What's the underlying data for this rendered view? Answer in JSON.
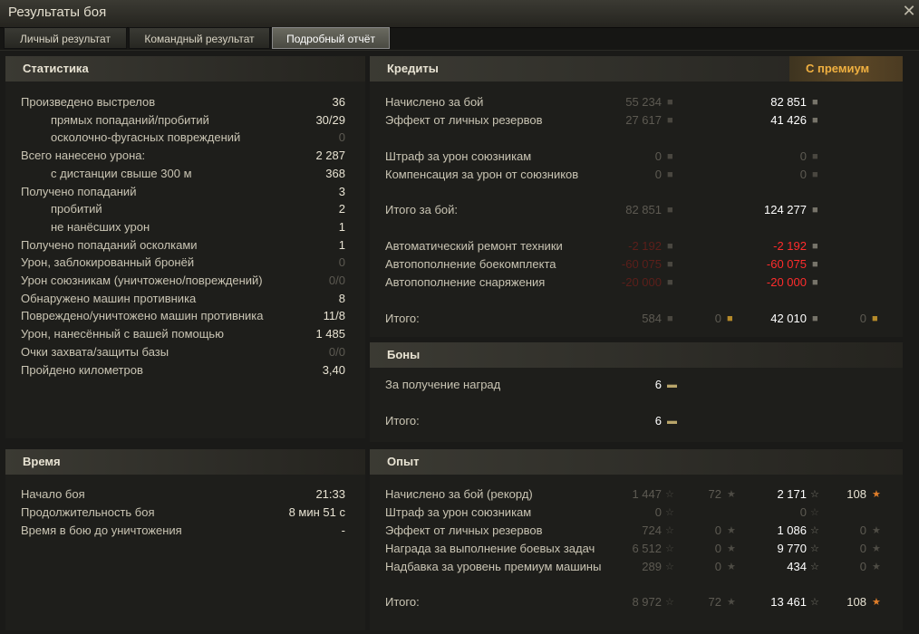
{
  "window": {
    "title": "Результаты боя"
  },
  "tabs": [
    "Личный результат",
    "Командный результат",
    "Подробный отчёт"
  ],
  "stats": {
    "header": "Статистика",
    "rows": [
      {
        "label": "Произведено выстрелов",
        "value": "36",
        "indent": false,
        "dim": false
      },
      {
        "label": "прямых попаданий/пробитий",
        "value": "30/29",
        "indent": true,
        "dim": false
      },
      {
        "label": "осколочно-фугасных повреждений",
        "value": "0",
        "indent": true,
        "dim": true
      },
      {
        "label": "Всего нанесено урона:",
        "value": "2 287",
        "indent": false,
        "dim": false
      },
      {
        "label": "с дистанции свыше 300 м",
        "value": "368",
        "indent": true,
        "dim": false
      },
      {
        "label": "Получено попаданий",
        "value": "3",
        "indent": false,
        "dim": false
      },
      {
        "label": "пробитий",
        "value": "2",
        "indent": true,
        "dim": false
      },
      {
        "label": "не нанёсших урон",
        "value": "1",
        "indent": true,
        "dim": false
      },
      {
        "label": "Получено попаданий осколками",
        "value": "1",
        "indent": false,
        "dim": false
      },
      {
        "label": "Урон, заблокированный бронёй",
        "value": "0",
        "indent": false,
        "dim": true
      },
      {
        "label": "Урон союзникам (уничтожено/повреждений)",
        "value": "0/0",
        "indent": false,
        "dim": true
      },
      {
        "label": "Обнаружено машин противника",
        "value": "8",
        "indent": false,
        "dim": false
      },
      {
        "label": "Повреждено/уничтожено машин противника",
        "value": "11/8",
        "indent": false,
        "dim": false
      },
      {
        "label": "Урон, нанесённый с вашей помощью",
        "value": "1 485",
        "indent": false,
        "dim": false
      },
      {
        "label": "Очки захвата/защиты базы",
        "value": "0/0",
        "indent": false,
        "dim": true
      },
      {
        "label": "Пройдено километров",
        "value": "3,40",
        "indent": false,
        "dim": false
      }
    ]
  },
  "time": {
    "header": "Время",
    "rows": [
      {
        "label": "Начало боя",
        "value": "21:33"
      },
      {
        "label": "Продолжительность боя",
        "value": "8 мин 51 с"
      },
      {
        "label": "Время в бою до уничтожения",
        "value": "-"
      }
    ]
  },
  "credits": {
    "header": "Кредиты",
    "premium_header": "С премиум",
    "rows": [
      {
        "label": "Начислено за бой",
        "base": "55 234",
        "prem": "82 851",
        "kind": "normal"
      },
      {
        "label": "Эффект от личных резервов",
        "base": "27 617",
        "prem": "41 426",
        "kind": "normal"
      },
      {
        "label": "Штраф за урон союзникам",
        "base": "0",
        "prem": "0",
        "kind": "zero"
      },
      {
        "label": "Компенсация за урон от союзников",
        "base": "0",
        "prem": "0",
        "kind": "zero"
      },
      {
        "label": "Итого за бой:",
        "base": "82 851",
        "prem": "124 277",
        "kind": "normal"
      },
      {
        "label": "Автоматический ремонт техники",
        "base": "-2 192",
        "prem": "-2 192",
        "kind": "red"
      },
      {
        "label": "Автопополнение боекомплекта",
        "base": "-60 075",
        "prem": "-60 075",
        "kind": "red"
      },
      {
        "label": "Автопополнение снаряжения",
        "base": "-20 000",
        "prem": "-20 000",
        "kind": "red"
      }
    ],
    "total": {
      "label": "Итого:",
      "base": "584",
      "base_gold": "0",
      "prem": "42 010",
      "prem_gold": "0"
    }
  },
  "bonds": {
    "header": "Боны",
    "rows": [
      {
        "label": "За получение наград",
        "value": "6"
      },
      {
        "label": "Итого:",
        "value": "6"
      }
    ]
  },
  "xp": {
    "header": "Опыт",
    "rows": [
      {
        "label": "Начислено за бой (рекорд)",
        "base": "1 447",
        "base_free": "72",
        "prem": "2 171",
        "prem_free": "108",
        "free_active": true
      },
      {
        "label": "Штраф за урон союзникам",
        "base": "0",
        "base_free": "",
        "prem": "0",
        "prem_free": "",
        "free_active": false
      },
      {
        "label": "Эффект от личных резервов",
        "base": "724",
        "base_free": "0",
        "prem": "1 086",
        "prem_free": "0",
        "free_active": false
      },
      {
        "label": "Награда за выполнение боевых задач",
        "base": "6 512",
        "base_free": "0",
        "prem": "9 770",
        "prem_free": "0",
        "free_active": false
      },
      {
        "label": "Надбавка за уровень премиум машины",
        "base": "289",
        "base_free": "0",
        "prem": "434",
        "prem_free": "0",
        "free_active": false
      }
    ],
    "total": {
      "label": "Итого:",
      "base": "8 972",
      "base_free": "72",
      "prem": "13 461",
      "prem_free": "108"
    }
  }
}
